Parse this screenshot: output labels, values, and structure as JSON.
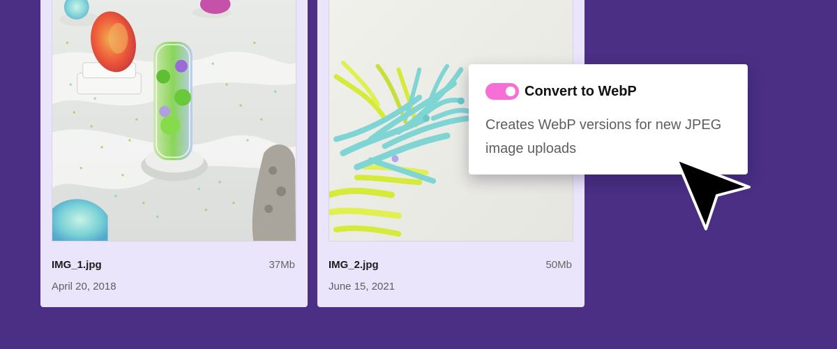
{
  "files": [
    {
      "name": "IMG_1.jpg",
      "size": "37Mb",
      "date": "April 20, 2018"
    },
    {
      "name": "IMG_2.jpg",
      "size": "50Mb",
      "date": "June 15, 2021"
    }
  ],
  "popover": {
    "title": "Convert to WebP",
    "description": "Creates WebP versions for new JPEG image uploads",
    "toggle_on": true
  },
  "colors": {
    "background": "#4a2f84",
    "card": "#ebe5fc",
    "toggle_accent": "#f66fd6"
  },
  "icons": {
    "pointer": "mouse-pointer-icon",
    "toggle": "toggle-switch-icon"
  }
}
